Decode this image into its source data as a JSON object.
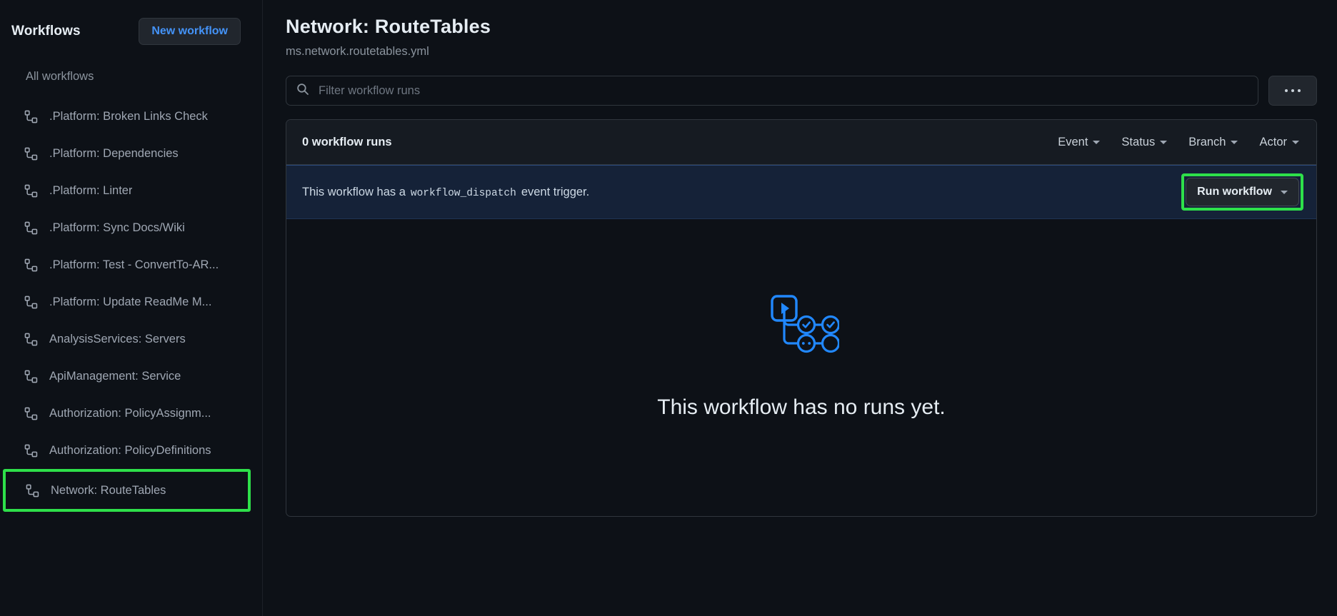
{
  "sidebar": {
    "title": "Workflows",
    "new_workflow_label": "New workflow",
    "all_workflows_label": "All workflows",
    "items": [
      {
        "label": ".Platform: Broken Links Check",
        "icon": "workflow-icon"
      },
      {
        "label": ".Platform: Dependencies",
        "icon": "workflow-icon"
      },
      {
        "label": ".Platform: Linter",
        "icon": "workflow-icon"
      },
      {
        "label": ".Platform: Sync Docs/Wiki",
        "icon": "workflow-icon"
      },
      {
        "label": ".Platform: Test - ConvertTo-AR...",
        "icon": "workflow-icon"
      },
      {
        "label": ".Platform: Update ReadMe M...",
        "icon": "workflow-icon"
      },
      {
        "label": "AnalysisServices: Servers",
        "icon": "workflow-icon"
      },
      {
        "label": "ApiManagement: Service",
        "icon": "workflow-icon"
      },
      {
        "label": "Authorization: PolicyAssignm...",
        "icon": "workflow-icon"
      },
      {
        "label": "Authorization: PolicyDefinitions",
        "icon": "workflow-icon"
      },
      {
        "label": "Network: RouteTables",
        "icon": "workflow-icon"
      }
    ]
  },
  "header": {
    "title": "Network: RouteTables",
    "subtitle": "ms.network.routetables.yml"
  },
  "search": {
    "placeholder": "Filter workflow runs",
    "value": "",
    "icon": "search-icon"
  },
  "toolbar": {
    "kebab_label": "...",
    "kebab_icon": "kebab-horizontal-icon"
  },
  "runs_panel": {
    "count_label": "0 workflow runs",
    "filters": [
      {
        "label": "Event"
      },
      {
        "label": "Status"
      },
      {
        "label": "Branch"
      },
      {
        "label": "Actor"
      }
    ]
  },
  "dispatch": {
    "text_before": "This workflow has a",
    "code": "workflow_dispatch",
    "text_after": "event trigger.",
    "run_button_label": "Run workflow"
  },
  "empty_state": {
    "title": "This workflow has no runs yet.",
    "illustration": "workflow-nodes-illustration"
  },
  "colors": {
    "highlight_green": "#2ee04a",
    "accent_blue": "#4493f8",
    "illustration_blue": "#2188ff",
    "banner_bg": "#152238"
  }
}
